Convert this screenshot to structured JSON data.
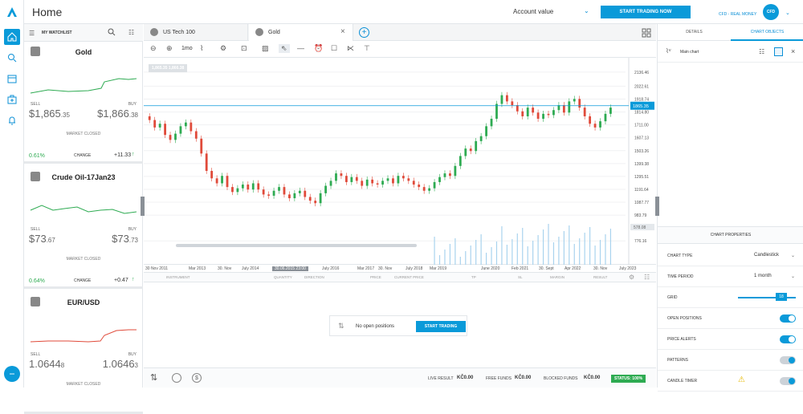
{
  "app": {
    "title": "Home",
    "logo": "A"
  },
  "header": {
    "account_label": "Account value",
    "start_trading": "START TRADING NOW",
    "account_name": "CFD - REAL MONEY",
    "avatar_initials": "CFD"
  },
  "watchlist": {
    "title": "MY WATCHLIST",
    "items": [
      {
        "name": "Gold",
        "sell_label": "SELL",
        "buy_label": "BUY",
        "sell_int": "$1,865",
        "sell_dec": ".35",
        "buy_int": "$1,866",
        "buy_dec": ".38",
        "status": "MARKET CLOSED",
        "pct": "0.61%",
        "change_label": "CHANGE",
        "change": "+11.33",
        "color": "#2eab52"
      },
      {
        "name": "Crude Oil-17Jan23",
        "sell_label": "SELL",
        "buy_label": "BUY",
        "sell_int": "$73",
        "sell_dec": ".67",
        "buy_int": "$73",
        "buy_dec": ".73",
        "status": "MARKET CLOSED",
        "pct": "0.64%",
        "change_label": "CHANGE",
        "change": "+0.47",
        "color": "#2eab52"
      },
      {
        "name": "EUR/USD",
        "sell_label": "SELL",
        "buy_label": "BUY",
        "sell_int": "1.0644",
        "sell_dec": "8",
        "buy_int": "1.0646",
        "buy_dec": "3",
        "status": "MARKET CLOSED",
        "color": "#e04a3a"
      }
    ]
  },
  "tabs": [
    {
      "label": "US Tech 100"
    },
    {
      "label": "Gold"
    }
  ],
  "toolbar": {
    "period": "1mo"
  },
  "chart": {
    "ohlc": "1,865.35  1,866.38",
    "last_price": "1865.35",
    "volume_tag": "578.08",
    "y_ticks": [
      "2136.46",
      "2022.61",
      "1918.74",
      "1814.80",
      "1711.00",
      "1607.13",
      "1503.26",
      "1399.38",
      "1295.51",
      "1191.64",
      "1087.77",
      "983.79",
      "776.16"
    ],
    "x_ticks": [
      "30 Nov 2011",
      "Mar 2013",
      "30. Nov",
      "July 2014",
      "30.06.2015 23:00",
      "July 2016",
      "Mar 2017",
      "30. Nov",
      "July 2018",
      "Mar 2019",
      "June 2020",
      "Feb 2021",
      "30. Sept",
      "Apr 2022",
      "30. Nov",
      "July 2023"
    ]
  },
  "chart_data": {
    "type": "candlestick",
    "title": "",
    "series": [
      {
        "values": [
          1750,
          1690,
          1720,
          1630,
          1590,
          1640,
          1700,
          1730,
          1660,
          1600,
          1480,
          1340,
          1280,
          1240,
          1300,
          1210,
          1170,
          1200,
          1230,
          1190,
          1240,
          1190,
          1150,
          1140,
          1180,
          1210,
          1150,
          1120,
          1160,
          1180,
          1130,
          1100,
          1080,
          1160,
          1220,
          1260,
          1320,
          1300,
          1250,
          1290,
          1260,
          1220,
          1270,
          1240,
          1230,
          1260,
          1280,
          1240,
          1300,
          1280,
          1260,
          1230,
          1210,
          1180,
          1200,
          1250,
          1290,
          1320,
          1300,
          1380,
          1460,
          1520,
          1500,
          1580,
          1620,
          1700,
          1760,
          1880,
          1950,
          1900,
          1870,
          1820,
          1780,
          1850,
          1810,
          1760,
          1800,
          1790,
          1830,
          1870,
          1810,
          1900,
          1920,
          1850,
          1780,
          1720,
          1690,
          1740,
          1800,
          1850
        ]
      }
    ]
  },
  "positions": {
    "headers": [
      "INSTRUMENT",
      "QUANTITY",
      "DIRECTION",
      "PRICE",
      "CURRENT PRICE",
      "TP",
      "SL",
      "MARGIN",
      "RESULT"
    ],
    "empty_text": "No open positions",
    "start_trading": "START TRADING"
  },
  "footer": {
    "live_result_label": "LIVE RESULT",
    "live_result": "KČ0.00",
    "free_funds_label": "FREE FUNDS",
    "free_funds": "KČ0.00",
    "blocked_funds_label": "BLOCKED FUNDS",
    "blocked_funds": "KČ0.00",
    "status": "STATUS: 100%"
  },
  "right": {
    "tabs": [
      "DETAILS",
      "CHART OBJECTS"
    ],
    "main_chart": "Main chart",
    "props_title": "CHART PROPERTIES",
    "props": [
      {
        "label": "CHART TYPE",
        "value": "Candlestick"
      },
      {
        "label": "TIME PERIOD",
        "value": "1 month"
      },
      {
        "label": "GRID",
        "value": "18"
      },
      {
        "label": "OPEN POSITIONS"
      },
      {
        "label": "PRICE ALERTS"
      },
      {
        "label": "PATTERNS"
      },
      {
        "label": "CANDLE TIMER"
      }
    ]
  },
  "colors": {
    "accent": "#0a9ad9",
    "up": "#2eab52",
    "down": "#e04a3a"
  }
}
